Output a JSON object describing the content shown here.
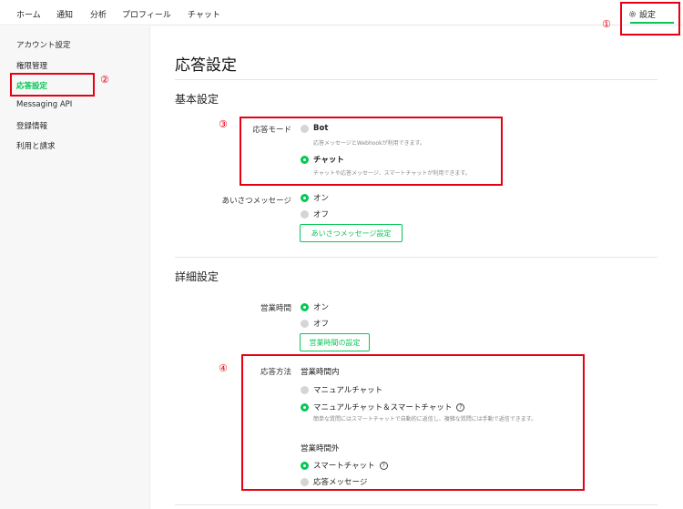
{
  "topnav": {
    "items": [
      "ホーム",
      "通知",
      "分析",
      "プロフィール",
      "チャット"
    ],
    "settings_label": "設定"
  },
  "sidebar": {
    "items": [
      "アカウント設定",
      "権限管理",
      "応答設定",
      "Messaging API",
      "登録情報",
      "利用と請求"
    ],
    "active_index": 2
  },
  "main": {
    "title": "応答設定",
    "basic": {
      "title": "基本設定",
      "response_mode": {
        "label": "応答モード",
        "options": [
          {
            "label": "Bot",
            "desc": "応答メッセージとWebhookが利用できます。",
            "selected": false
          },
          {
            "label": "チャット",
            "desc": "チャットや応答メッセージ、スマートチャットが利用できます。",
            "selected": true
          }
        ]
      },
      "greeting": {
        "label": "あいさつメッセージ",
        "options": [
          {
            "label": "オン",
            "selected": true
          },
          {
            "label": "オフ",
            "selected": false
          }
        ],
        "button": "あいさつメッセージ設定"
      }
    },
    "detail": {
      "title": "詳細設定",
      "hours": {
        "label": "営業時間",
        "options": [
          {
            "label": "オン",
            "selected": true
          },
          {
            "label": "オフ",
            "selected": false
          }
        ],
        "button": "営業時間の設定"
      },
      "method": {
        "label": "応答方法",
        "in_hours": {
          "heading": "営業時間内",
          "options": [
            {
              "label": "マニュアルチャット",
              "selected": false
            },
            {
              "label": "マニュアルチャット＆スマートチャット",
              "selected": true
            }
          ],
          "desc": "簡単な質問にはスマートチャットで自動的に返信し、複雑な質問には手動で返信できます。"
        },
        "out_hours": {
          "heading": "営業時間外",
          "options": [
            {
              "label": "スマートチャット",
              "selected": true
            },
            {
              "label": "応答メッセージ",
              "selected": false
            }
          ]
        }
      }
    }
  },
  "annotations": {
    "n1": "①",
    "n2": "②",
    "n3": "③",
    "n4": "④",
    "color": "#e60012"
  },
  "colors": {
    "accent": "#06c755",
    "annotation": "#e60012"
  },
  "icons": {
    "settings": "gear-icon",
    "help": "question-circle-icon"
  }
}
